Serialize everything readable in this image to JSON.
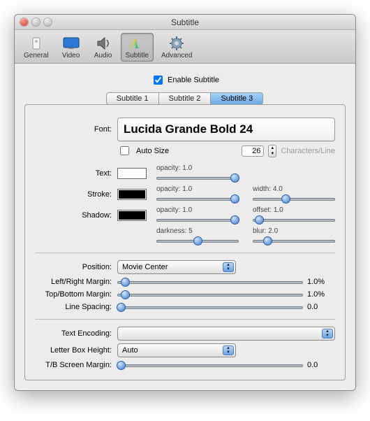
{
  "window": {
    "title": "Subtitle"
  },
  "toolbar": {
    "general": "General",
    "video": "Video",
    "audio": "Audio",
    "subtitle": "Subtitle",
    "advanced": "Advanced"
  },
  "enable": {
    "label": "Enable Subtitle",
    "checked": true
  },
  "tabs": [
    "Subtitle 1",
    "Subtitle 2",
    "Subtitle 3"
  ],
  "font": {
    "label": "Font:",
    "name": "Lucida Grande Bold 24",
    "autosize_label": "Auto Size",
    "autosize_checked": false,
    "chars": "26",
    "chars_unit": "Characters/Line"
  },
  "text": {
    "label": "Text:",
    "color": "#ffffff",
    "opacity_label": "opacity:",
    "opacity": "1.0"
  },
  "stroke": {
    "label": "Stroke:",
    "color": "#000000",
    "opacity_label": "opacity:",
    "opacity": "1.0",
    "width_label": "width:",
    "width": "4.0"
  },
  "shadow": {
    "label": "Shadow:",
    "color": "#000000",
    "opacity_label": "opacity:",
    "opacity": "1.0",
    "offset_label": "offset:",
    "offset": "1.0",
    "darkness_label": "darkness:",
    "darkness": "5",
    "blur_label": "blur:",
    "blur": "2.0"
  },
  "position": {
    "label": "Position:",
    "value": "Movie Center"
  },
  "lrmargin": {
    "label": "Left/Right Margin:",
    "value": "1.0%"
  },
  "tbmargin": {
    "label": "Top/Bottom Margin:",
    "value": "1.0%"
  },
  "linespacing": {
    "label": "Line Spacing:",
    "value": "0.0"
  },
  "textencoding": {
    "label": "Text Encoding:",
    "value": ""
  },
  "letterbox": {
    "label": "Letter Box Height:",
    "value": "Auto"
  },
  "tbscreen": {
    "label": "T/B Screen Margin:",
    "value": "0.0"
  }
}
